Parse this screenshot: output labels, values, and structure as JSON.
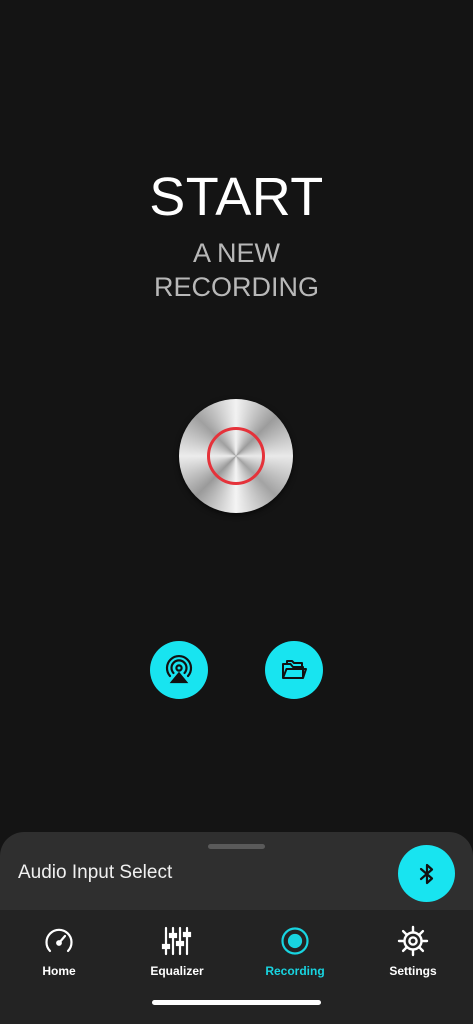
{
  "hero": {
    "title": "START",
    "subtitle_line1": "A NEW",
    "subtitle_line2": "RECORDING"
  },
  "controls": {
    "record_icon": "record-icon",
    "airplay_icon": "airplay-icon",
    "folder_icon": "folder-icon"
  },
  "sheet": {
    "label": "Audio Input Select",
    "bluetooth_icon": "bluetooth-icon"
  },
  "tabs": [
    {
      "label": "Home",
      "icon": "speedometer-icon",
      "active": false
    },
    {
      "label": "Equalizer",
      "icon": "equalizer-icon",
      "active": false
    },
    {
      "label": "Recording",
      "icon": "record-icon",
      "active": true
    },
    {
      "label": "Settings",
      "icon": "gear-icon",
      "active": false
    }
  ],
  "colors": {
    "background": "#141414",
    "accent": "#18e4f0",
    "record_ring": "#e5323a",
    "sheet": "#2f2f2f",
    "tabbar": "#232323",
    "active_tab": "#18d4e0"
  }
}
